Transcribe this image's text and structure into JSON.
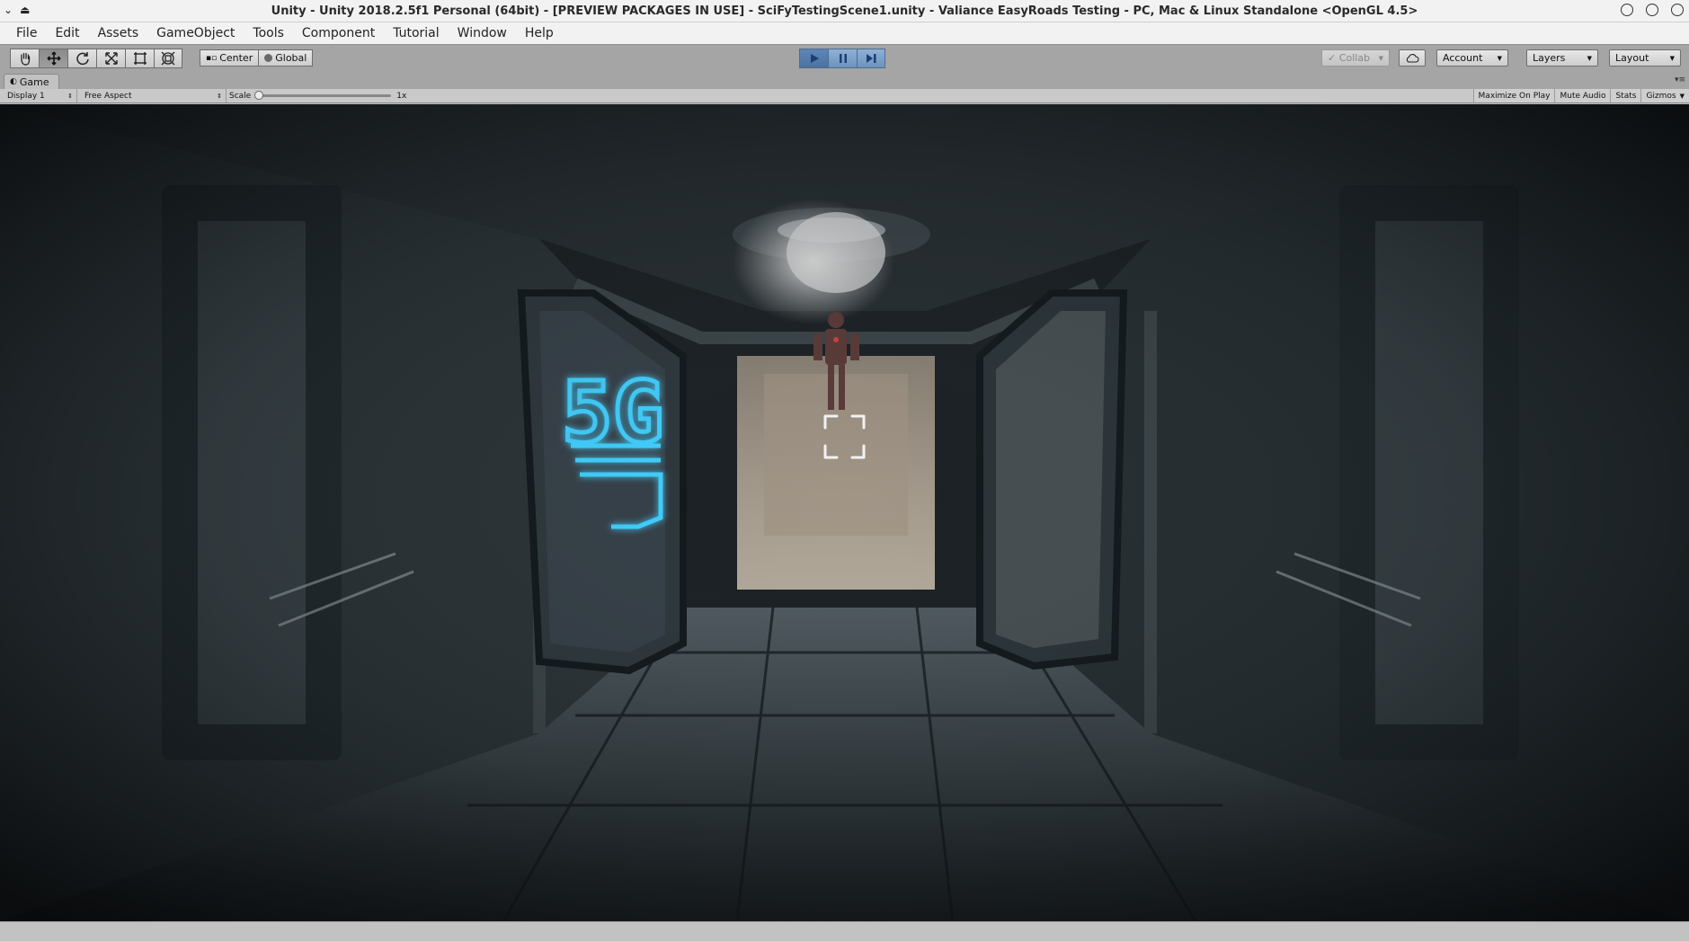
{
  "titlebar": {
    "title": "Unity - Unity 2018.2.5f1 Personal (64bit) - [PREVIEW PACKAGES IN USE] - SciFyTestingScene1.unity - Valiance EasyRoads Testing - PC, Mac & Linux Standalone <OpenGL 4.5>"
  },
  "menu": [
    "File",
    "Edit",
    "Assets",
    "GameObject",
    "Tools",
    "Component",
    "Tutorial",
    "Window",
    "Help"
  ],
  "toolbar": {
    "tools": [
      "hand-tool-icon",
      "move-tool-icon",
      "rotate-tool-icon",
      "scale-tool-icon",
      "rect-tool-icon",
      "transform-tool-icon"
    ],
    "pivot_label": "Center",
    "space_label": "Global",
    "collab_label": "Collab",
    "account_label": "Account",
    "layers_label": "Layers",
    "layout_label": "Layout"
  },
  "game": {
    "tab_label": "Game",
    "display": "Display 1",
    "aspect": "Free Aspect",
    "scale_label": "Scale",
    "scale_value": "1x",
    "maximize": "Maximize On Play",
    "mute": "Mute Audio",
    "stats": "Stats",
    "gizmos": "Gizmos",
    "sign_text": "5G"
  },
  "colors": {
    "play_active": "#4b72a0",
    "neon_sign": "#3fd0ff",
    "toolbar_bg": "#a5a5a5"
  }
}
